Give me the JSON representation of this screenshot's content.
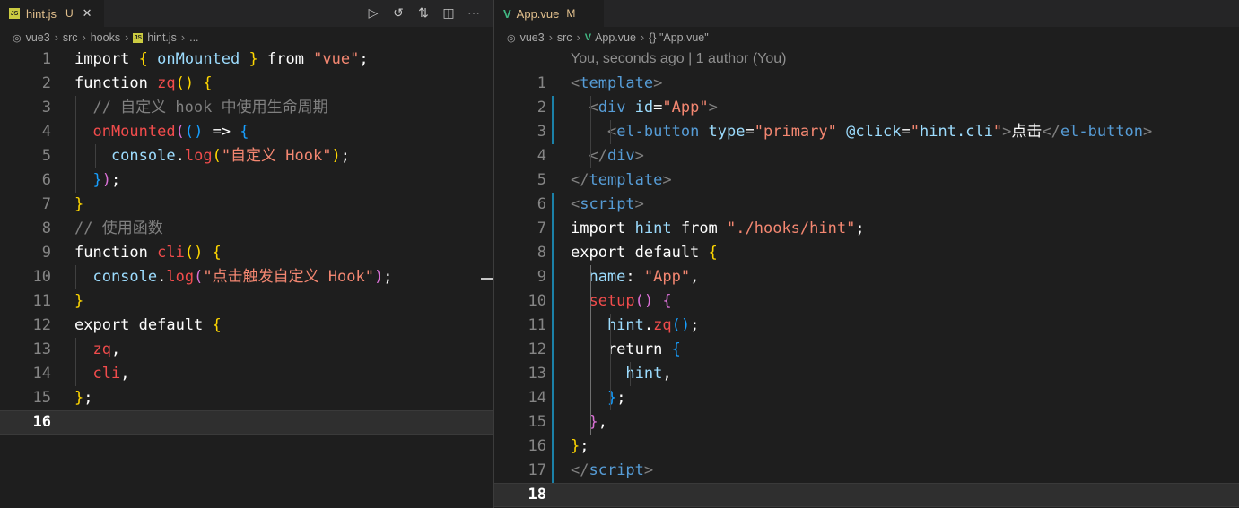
{
  "left": {
    "tab": {
      "icon_label": "JS",
      "name": "hint.js",
      "status": "U"
    },
    "actions": [
      "run-icon",
      "history-icon",
      "compare-icon",
      "split-editor-icon",
      "more-icon"
    ],
    "breadcrumb": [
      "vue3",
      "src",
      "hooks",
      "hint.js",
      "..."
    ],
    "active_line": 16,
    "lines": [
      [
        [
          "t-white",
          "import "
        ],
        [
          "t-br1",
          "{ "
        ],
        [
          "t-var",
          "onMounted"
        ],
        [
          "t-br1",
          " }"
        ],
        [
          "t-white",
          " from "
        ],
        [
          "t-strr",
          "\"vue\""
        ],
        [
          "t-white",
          ";"
        ]
      ],
      [
        [
          "t-white",
          "function "
        ],
        [
          "t-fn",
          "zq"
        ],
        [
          "t-br1",
          "() {"
        ]
      ],
      [
        [
          "t-gray",
          "  // 自定义 hook 中使用生命周期"
        ]
      ],
      [
        [
          "t-fn",
          "  onMounted"
        ],
        [
          "t-br2",
          "("
        ],
        [
          "t-br3",
          "()"
        ],
        [
          "t-white",
          " => "
        ],
        [
          "t-br3",
          "{"
        ]
      ],
      [
        [
          "t-var",
          "    console"
        ],
        [
          "t-white",
          "."
        ],
        [
          "t-fn",
          "log"
        ],
        [
          "t-br1",
          "("
        ],
        [
          "t-strr",
          "\"自定义 Hook\""
        ],
        [
          "t-br1",
          ")"
        ],
        [
          "t-white",
          ";"
        ]
      ],
      [
        [
          "t-br3",
          "  }"
        ],
        [
          "t-br2",
          ")"
        ],
        [
          "t-white",
          ";"
        ]
      ],
      [
        [
          "t-br1",
          "}"
        ]
      ],
      [
        [
          "t-gray",
          "// 使用函数"
        ]
      ],
      [
        [
          "t-white",
          "function "
        ],
        [
          "t-fn",
          "cli"
        ],
        [
          "t-br1",
          "() {"
        ]
      ],
      [
        [
          "t-var",
          "  console"
        ],
        [
          "t-white",
          "."
        ],
        [
          "t-fn",
          "log"
        ],
        [
          "t-br2",
          "("
        ],
        [
          "t-strr",
          "\"点击触发自定义 Hook\""
        ],
        [
          "t-br2",
          ")"
        ],
        [
          "t-white",
          ";"
        ]
      ],
      [
        [
          "t-br1",
          "}"
        ]
      ],
      [
        [
          "t-white",
          "export default "
        ],
        [
          "t-br1",
          "{"
        ]
      ],
      [
        [
          "t-fn",
          "  zq"
        ],
        [
          "t-white",
          ","
        ]
      ],
      [
        [
          "t-fn",
          "  cli"
        ],
        [
          "t-white",
          ","
        ]
      ],
      [
        [
          "t-br1",
          "}"
        ],
        [
          "t-white",
          ";"
        ]
      ],
      []
    ]
  },
  "right": {
    "tab": {
      "name": "App.vue",
      "status": "M"
    },
    "breadcrumb": [
      "vue3",
      "src",
      "App.vue",
      "{} \"App.vue\""
    ],
    "blame": "You, seconds ago | 1 author (You)",
    "active_line": 18,
    "lines": [
      [
        [
          "t-gray",
          "<"
        ],
        [
          "t-tag",
          "template"
        ],
        [
          "t-gray",
          ">"
        ]
      ],
      [
        [
          "t-gray",
          "  <"
        ],
        [
          "t-tag",
          "div"
        ],
        [
          "t-attr",
          " id"
        ],
        [
          "t-white",
          "="
        ],
        [
          "t-strr",
          "\"App\""
        ],
        [
          "t-gray",
          ">"
        ]
      ],
      [
        [
          "t-gray",
          "    <"
        ],
        [
          "t-tag",
          "el-button"
        ],
        [
          "t-attr",
          " type"
        ],
        [
          "t-white",
          "="
        ],
        [
          "t-strr",
          "\"primary\""
        ],
        [
          "t-attr",
          " @click"
        ],
        [
          "t-white",
          "="
        ],
        [
          "t-strr",
          "\""
        ],
        [
          "t-var",
          "hint.cli"
        ],
        [
          "t-strr",
          "\""
        ],
        [
          "t-gray",
          ">"
        ],
        [
          "t-white",
          "点击"
        ],
        [
          "t-gray",
          "</"
        ],
        [
          "t-tag",
          "el-button"
        ],
        [
          "t-gray",
          ">"
        ]
      ],
      [
        [
          "t-gray",
          "  </"
        ],
        [
          "t-tag",
          "div"
        ],
        [
          "t-gray",
          ">"
        ]
      ],
      [
        [
          "t-gray",
          "</"
        ],
        [
          "t-tag",
          "template"
        ],
        [
          "t-gray",
          ">"
        ]
      ],
      [
        [
          "t-gray",
          "<"
        ],
        [
          "t-tag",
          "script"
        ],
        [
          "t-gray",
          ">"
        ]
      ],
      [
        [
          "t-white",
          "import "
        ],
        [
          "t-var",
          "hint"
        ],
        [
          "t-white",
          " from "
        ],
        [
          "t-strr",
          "\"./hooks/hint\""
        ],
        [
          "t-white",
          ";"
        ]
      ],
      [
        [
          "t-white",
          "export default "
        ],
        [
          "t-br1",
          "{"
        ]
      ],
      [
        [
          "t-var",
          "  name"
        ],
        [
          "t-white",
          ": "
        ],
        [
          "t-strr",
          "\"App\""
        ],
        [
          "t-white",
          ","
        ]
      ],
      [
        [
          "t-fn",
          "  setup"
        ],
        [
          "t-br2",
          "() {"
        ]
      ],
      [
        [
          "t-var",
          "    hint"
        ],
        [
          "t-white",
          "."
        ],
        [
          "t-fn",
          "zq"
        ],
        [
          "t-br3",
          "()"
        ],
        [
          "t-white",
          ";"
        ]
      ],
      [
        [
          "t-white",
          "    return "
        ],
        [
          "t-br3",
          "{"
        ]
      ],
      [
        [
          "t-var",
          "      hint"
        ],
        [
          "t-white",
          ","
        ]
      ],
      [
        [
          "t-br3",
          "    }"
        ],
        [
          "t-white",
          ";"
        ]
      ],
      [
        [
          "t-br2",
          "  }"
        ],
        [
          "t-white",
          ","
        ]
      ],
      [
        [
          "t-br1",
          "}"
        ],
        [
          "t-white",
          ";"
        ]
      ],
      [
        [
          "t-gray",
          "</"
        ],
        [
          "t-tag",
          "script"
        ],
        [
          "t-gray",
          ">"
        ]
      ],
      []
    ]
  }
}
